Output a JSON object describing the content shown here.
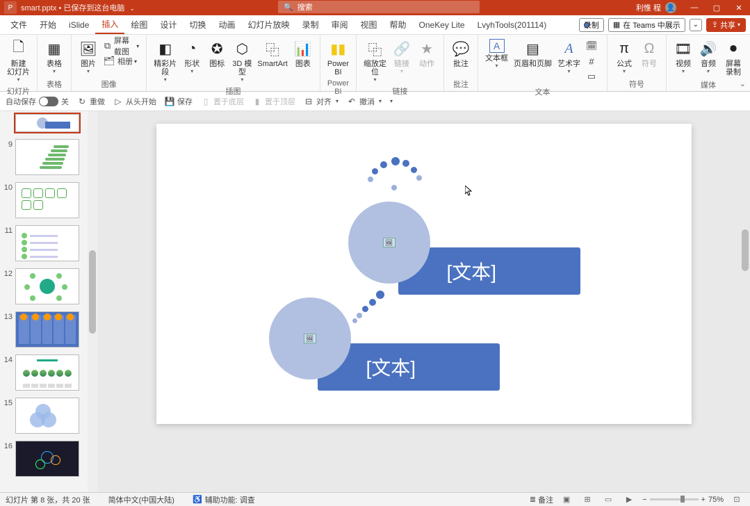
{
  "titlebar": {
    "filename": "smart.pptx",
    "saved_msg": "已保存到这台电脑",
    "search_placeholder": "搜索",
    "username": "利惟 程"
  },
  "menu": {
    "tabs": [
      "文件",
      "开始",
      "iSlide",
      "插入",
      "绘图",
      "设计",
      "切换",
      "动画",
      "幻灯片放映",
      "录制",
      "审阅",
      "视图",
      "帮助",
      "OneKey Lite",
      "LvyhTools(201114)"
    ],
    "active_index": 3,
    "record": "录制",
    "teams": "在 Teams 中展示",
    "share": "共享"
  },
  "ribbon": {
    "groups": {
      "slides": {
        "label": "幻灯片",
        "new_slide": "新建\n幻灯片"
      },
      "tables": {
        "label": "表格",
        "table": "表格"
      },
      "images": {
        "label": "图像",
        "pic": "图片",
        "screenshot": "屏幕截图",
        "album": "相册"
      },
      "inserts": {
        "label": "插图",
        "special": "精彩片\n段",
        "shapes": "形状",
        "icons": "图标",
        "threed": "3D 模\n型",
        "smartart": "SmartArt",
        "chart": "图表"
      },
      "powerbi": {
        "label": "Power BI",
        "btn": "Power\nBI"
      },
      "links": {
        "label": "链接",
        "zoom": "缩放定\n位",
        "link": "链接",
        "action": "动作"
      },
      "comments": {
        "label": "批注",
        "btn": "批注"
      },
      "text": {
        "label": "文本",
        "textbox": "文本框",
        "headerfooter": "页眉和页脚",
        "wordart": "艺术字"
      },
      "symbols": {
        "label": "符号",
        "eq": "公式",
        "sym": "符号"
      },
      "media": {
        "label": "媒体",
        "video": "视频",
        "audio": "音频",
        "screenrec": "屏幕\n录制"
      }
    }
  },
  "secbar": {
    "autosave": "自动保存",
    "off": "关",
    "redo": "重做",
    "from_begin": "从头开始",
    "save": "保存",
    "reuse": "置于底层",
    "tofront": "置于顶层",
    "align": "对齐",
    "undo": "撤消"
  },
  "thumbs": [
    {
      "num": "",
      "kind": "partial"
    },
    {
      "num": "9",
      "kind": "greensteps"
    },
    {
      "num": "10",
      "kind": "hex"
    },
    {
      "num": "11",
      "kind": "list"
    },
    {
      "num": "12",
      "kind": "center"
    },
    {
      "num": "13",
      "kind": "cols"
    },
    {
      "num": "14",
      "kind": "row"
    },
    {
      "num": "15",
      "kind": "venn"
    },
    {
      "num": "16",
      "kind": "dark"
    }
  ],
  "slide": {
    "text_placeholder": "[文本]"
  },
  "status": {
    "slide_info": "幻灯片 第 8 张，共 20 张",
    "lang": "简体中文(中国大陆)",
    "access": "辅助功能: 调查",
    "notes": "备注",
    "zoom_pct": "75%"
  }
}
